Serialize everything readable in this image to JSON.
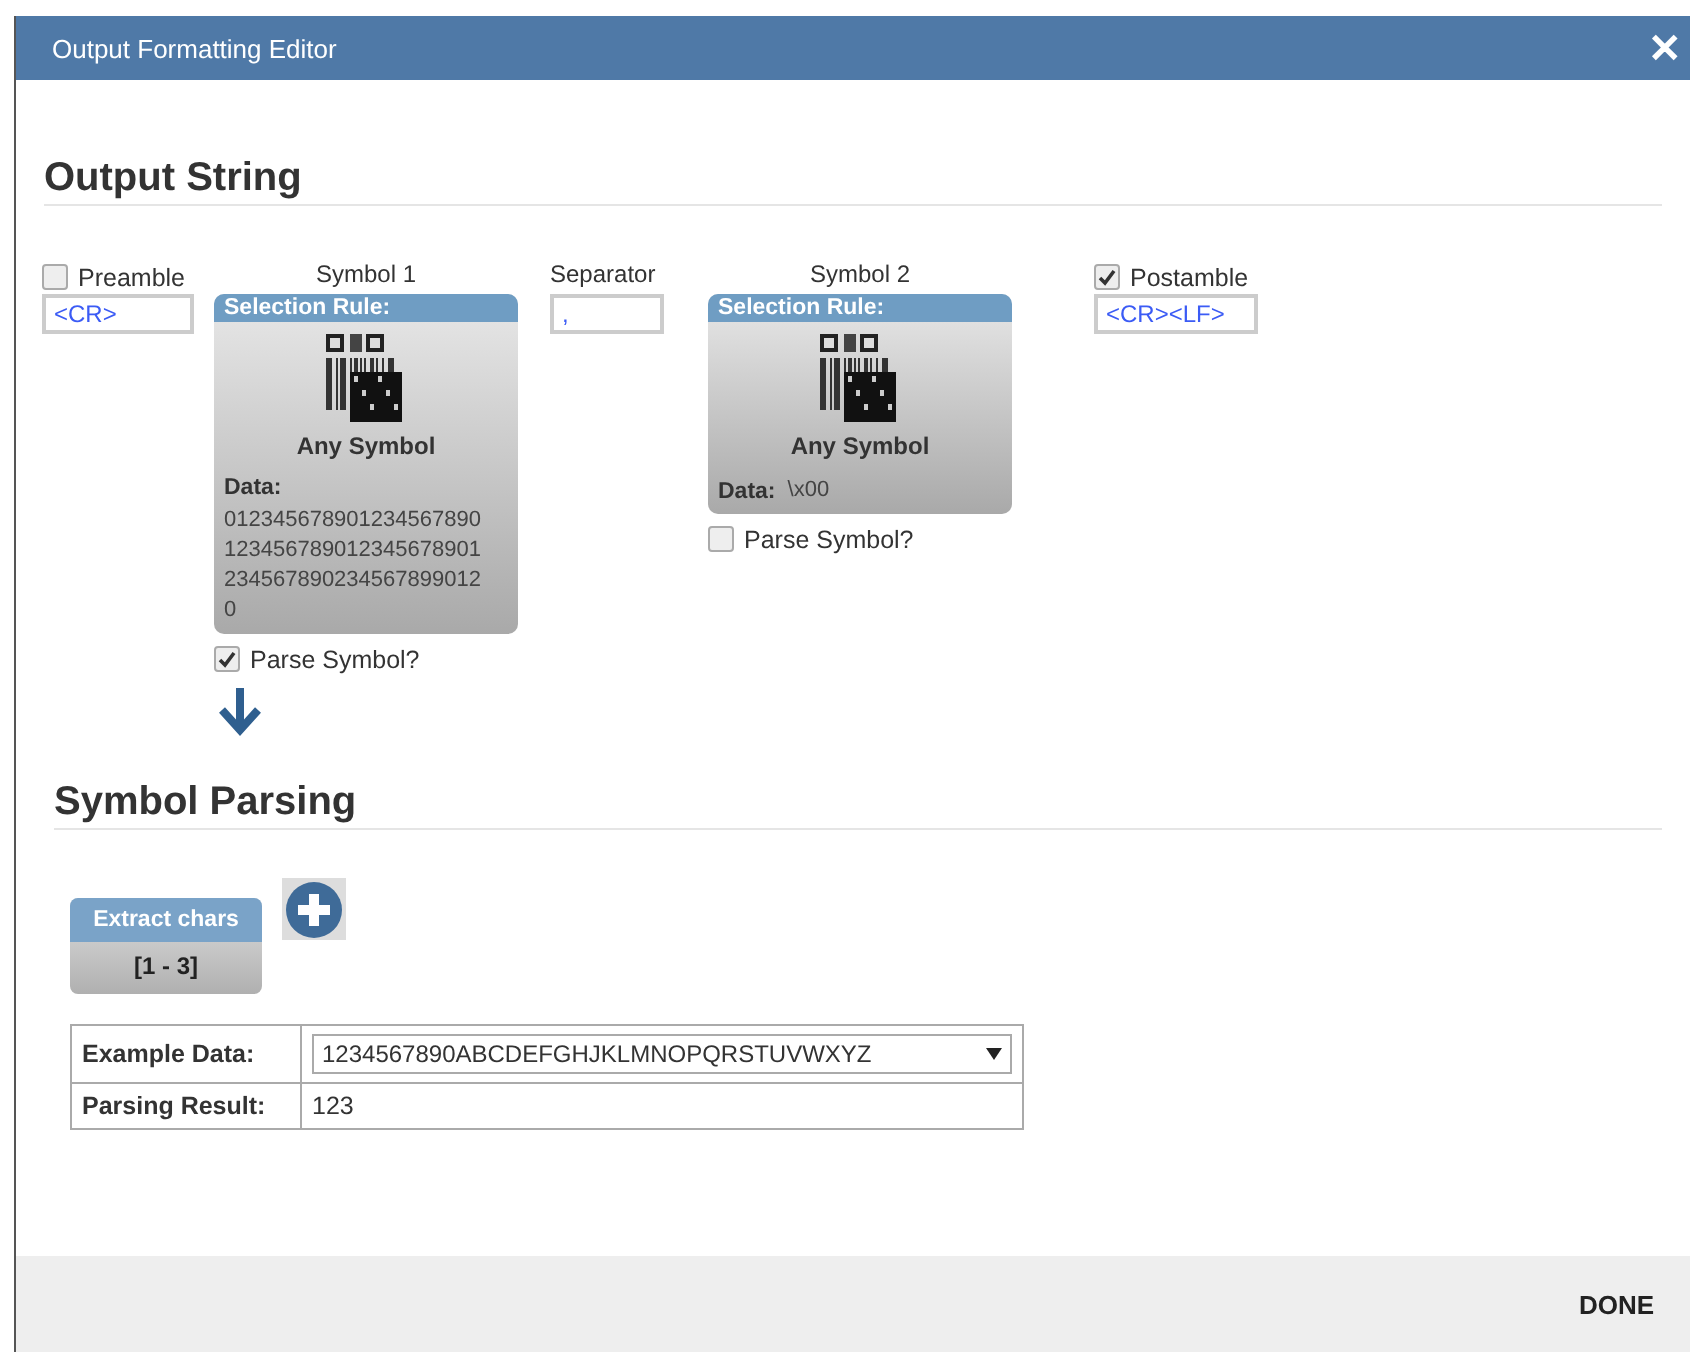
{
  "window": {
    "title": "Output Formatting Editor",
    "close": "✕"
  },
  "output_string": {
    "heading": "Output String",
    "preamble": {
      "label": "Preamble",
      "checked": false,
      "value": "<CR>"
    },
    "symbols": [
      {
        "label": "Symbol 1",
        "rule_label": "Selection Rule:",
        "symbol_name": "Any Symbol",
        "data_label": "Data:",
        "data": "0123456789012345678901234567890123456789012345678902345678990120",
        "parse_label": "Parse Symbol?",
        "parse": true
      },
      {
        "label": "Symbol 2",
        "rule_label": "Selection Rule:",
        "symbol_name": "Any Symbol",
        "data_label": "Data:",
        "data": "\\x00",
        "parse_label": "Parse Symbol?",
        "parse": false
      }
    ],
    "separator": {
      "label": "Separator",
      "value": ","
    },
    "postamble": {
      "label": "Postamble",
      "checked": true,
      "value": "<CR><LF>"
    }
  },
  "symbol_parsing": {
    "heading": "Symbol Parsing",
    "rules": [
      {
        "title": "Extract chars",
        "range": "[1 - 3]"
      }
    ],
    "table": [
      {
        "label": "Example Data:",
        "kind": "select",
        "value": "1234567890ABCDEFGHJKLMNOPQRSTUVWXYZ"
      },
      {
        "label": "Parsing Result:",
        "kind": "text",
        "value": "123"
      }
    ]
  },
  "footer": {
    "button": "DONE"
  }
}
